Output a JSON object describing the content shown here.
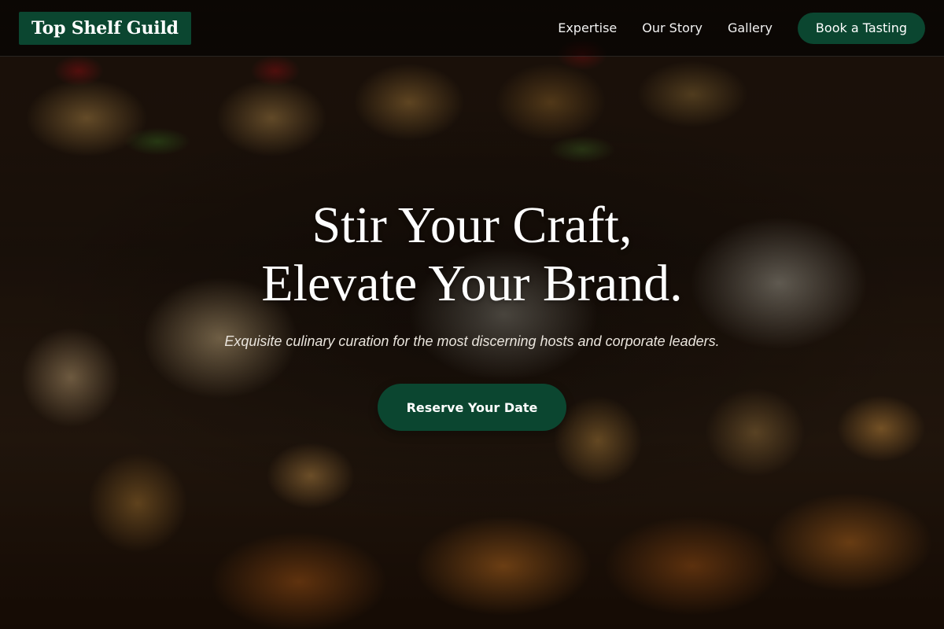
{
  "nav": {
    "brand": "Top Shelf Guild",
    "links": [
      {
        "label": "Expertise"
      },
      {
        "label": "Our Story"
      },
      {
        "label": "Gallery"
      }
    ],
    "cta_label": "Book a Tasting"
  },
  "hero": {
    "title_line1": "Stir Your Craft,",
    "title_line2": "Elevate Your Brand.",
    "subtitle": "Exquisite culinary curation for the most discerning hosts and corporate leaders.",
    "cta_label": "Reserve Your Date"
  },
  "colors": {
    "brand_green": "#0b4630",
    "nav_background": "rgba(0,0,0,0.55)",
    "text_light": "#ffffff"
  }
}
